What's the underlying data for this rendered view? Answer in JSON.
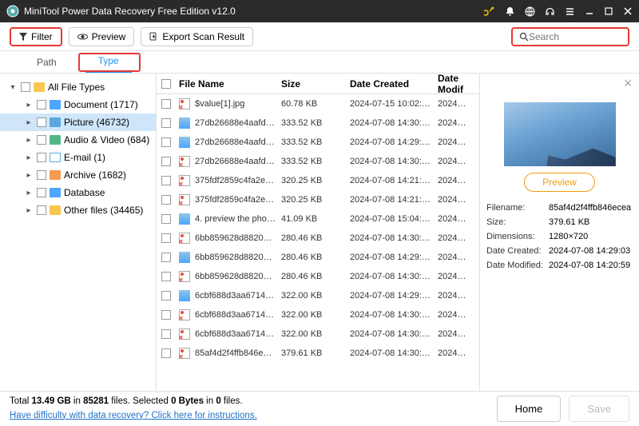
{
  "titlebar": {
    "title": "MiniTool Power Data Recovery Free Edition v12.0"
  },
  "toolbar": {
    "filter": "Filter",
    "preview": "Preview",
    "export": "Export Scan Result",
    "search_placeholder": "Search"
  },
  "tabs": {
    "path": "Path",
    "type": "Type"
  },
  "sidebar": {
    "root": "All File Types",
    "items": [
      {
        "label": "Document (1717)",
        "color": "folder-blue"
      },
      {
        "label": "Picture (46732)",
        "color": "folder-pict",
        "selected": true
      },
      {
        "label": "Audio & Video (684)",
        "color": "folder-green"
      },
      {
        "label": "E-mail (1)",
        "color": "folder-white"
      },
      {
        "label": "Archive (1682)",
        "color": "folder-orange"
      },
      {
        "label": "Database",
        "color": "folder-blue"
      },
      {
        "label": "Other files (34465)",
        "color": "folder-yellow"
      }
    ]
  },
  "headers": {
    "name": "File Name",
    "size": "Size",
    "created": "Date Created",
    "modified": "Date Modif"
  },
  "files": [
    {
      "name": "$value[1].jpg",
      "size": "60.78 KB",
      "created": "2024-07-15 10:02:…",
      "mod": "2024…",
      "x": true,
      "blue": false
    },
    {
      "name": "27db26688e4aafd…",
      "size": "333.52 KB",
      "created": "2024-07-08 14:30:…",
      "mod": "2024…",
      "x": false,
      "blue": true
    },
    {
      "name": "27db26688e4aafd…",
      "size": "333.52 KB",
      "created": "2024-07-08 14:29:…",
      "mod": "2024…",
      "x": false,
      "blue": true
    },
    {
      "name": "27db26688e4aafd…",
      "size": "333.52 KB",
      "created": "2024-07-08 14:30:…",
      "mod": "2024…",
      "x": true,
      "blue": false
    },
    {
      "name": "375fdf2859c4fa2e…",
      "size": "320.25 KB",
      "created": "2024-07-08 14:21:…",
      "mod": "2024…",
      "x": true,
      "blue": false
    },
    {
      "name": "375fdf2859c4fa2e…",
      "size": "320.25 KB",
      "created": "2024-07-08 14:21:…",
      "mod": "2024…",
      "x": true,
      "blue": false
    },
    {
      "name": "4. preview the pho…",
      "size": "41.09 KB",
      "created": "2024-07-08 15:04:…",
      "mod": "2024…",
      "x": false,
      "blue": true
    },
    {
      "name": "6bb859628d8820…",
      "size": "280.46 KB",
      "created": "2024-07-08 14:30:…",
      "mod": "2024…",
      "x": true,
      "blue": false
    },
    {
      "name": "6bb859628d8820…",
      "size": "280.46 KB",
      "created": "2024-07-08 14:29:…",
      "mod": "2024…",
      "x": false,
      "blue": true
    },
    {
      "name": "6bb859628d8820…",
      "size": "280.46 KB",
      "created": "2024-07-08 14:30:…",
      "mod": "2024…",
      "x": true,
      "blue": false
    },
    {
      "name": "6cbf688d3aa6714…",
      "size": "322.00 KB",
      "created": "2024-07-08 14:29:…",
      "mod": "2024…",
      "x": false,
      "blue": true
    },
    {
      "name": "6cbf688d3aa6714…",
      "size": "322.00 KB",
      "created": "2024-07-08 14:30:…",
      "mod": "2024…",
      "x": true,
      "blue": false
    },
    {
      "name": "6cbf688d3aa6714…",
      "size": "322.00 KB",
      "created": "2024-07-08 14:30:…",
      "mod": "2024…",
      "x": true,
      "blue": false
    },
    {
      "name": "85af4d2f4ffb846e…",
      "size": "379.61 KB",
      "created": "2024-07-08 14:30:…",
      "mod": "2024…",
      "x": true,
      "blue": false
    }
  ],
  "preview": {
    "button": "Preview",
    "meta": {
      "filename_k": "Filename:",
      "filename_v": "85af4d2f4ffb846ecea",
      "size_k": "Size:",
      "size_v": "379.61 KB",
      "dim_k": "Dimensions:",
      "dim_v": "1280×720",
      "created_k": "Date Created:",
      "created_v": "2024-07-08 14:29:03",
      "mod_k": "Date Modified:",
      "mod_v": "2024-07-08 14:20:59"
    }
  },
  "footer": {
    "total_prefix": "Total ",
    "total_gb": "13.49 GB",
    "total_mid": " in ",
    "total_files": "85281",
    "total_suffix": " files. ",
    "sel_prefix": " Selected ",
    "sel_bytes": "0 Bytes",
    "sel_mid": " in ",
    "sel_files": "0",
    "sel_suffix": " files.",
    "help_link": "Have difficulty with data recovery? Click here for instructions.",
    "home": "Home",
    "save": "Save"
  }
}
